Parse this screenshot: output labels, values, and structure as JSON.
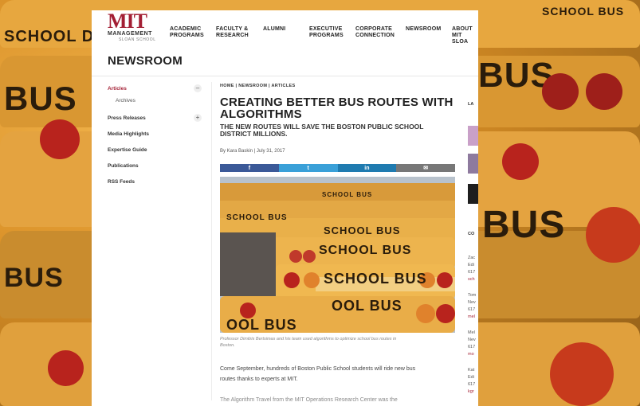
{
  "logo": {
    "mark": "MIT",
    "line1": "MANAGEMENT",
    "line2": "SLOAN SCHOOL"
  },
  "nav": [
    {
      "line1": "ACADEMIC",
      "line2": "PROGRAMS"
    },
    {
      "line1": "FACULTY &",
      "line2": "RESEARCH"
    },
    {
      "line1": "ALUMNI",
      "line2": ""
    },
    {
      "line1": "EXECUTIVE",
      "line2": "PROGRAMS"
    },
    {
      "line1": "CORPORATE",
      "line2": "CONNECTION"
    },
    {
      "line1": "NEWSROOM",
      "line2": ""
    },
    {
      "line1": "ABOUT",
      "line2": "MIT SLOA"
    }
  ],
  "page_title": "NEWSROOM",
  "sidebar": {
    "items": [
      {
        "label": "Articles",
        "toggle": "–"
      },
      {
        "label": "Archives"
      },
      {
        "label": "Press Releases",
        "toggle": "+"
      },
      {
        "label": "Media Highlights"
      },
      {
        "label": "Expertise Guide"
      },
      {
        "label": "Publications"
      },
      {
        "label": "RSS Feeds"
      }
    ]
  },
  "article": {
    "breadcrumb": [
      "HOME",
      "NEWSROOM",
      "ARTICLES"
    ],
    "breadcrumb_sep": "|",
    "headline_line1": "CREATING BETTER BUS ROUTES WITH",
    "headline_line2": "ALGORITHMS",
    "subhead_line1": "THE NEW ROUTES WILL SAVE THE BOSTON PUBLIC SCHOOL",
    "subhead_line2": "DISTRICT MILLIONS.",
    "byline": "By Kara Baskin  |  July 31, 2017",
    "share": {
      "facebook": "f",
      "twitter": "t",
      "linkedin": "in",
      "email": "✉",
      "colors": {
        "facebook": "#3b5998",
        "twitter": "#3aa0d8",
        "linkedin": "#1f7bb0",
        "email": "#777777"
      }
    },
    "photo_words": [
      "SCHOOL BUS",
      "SCHOOL BUS",
      "SCHOOL BUS",
      "SCHOOL BUS",
      "SCHOOL BUS",
      "OOL BUS",
      "OOL BUS"
    ],
    "caption_line1": "Professor Dimitris Bertsimas and his team used algorithms to optimize school bus routes in",
    "caption_line2": "Boston.",
    "body_line1": "Come September, hundreds of Boston Public School students will ride new bus",
    "body_line2": "routes thanks to experts at MIT.",
    "body_next": "The Algorithm Travel from the MIT Operations Research Center was the"
  },
  "right_col": {
    "latest": "LA",
    "contact": "CO",
    "lines": [
      {
        "text": "Zac",
        "link": false
      },
      {
        "text": "Edi",
        "link": false
      },
      {
        "text": "617",
        "link": false
      },
      {
        "text": "sch",
        "link": true
      },
      {
        "text": "Tom",
        "link": false
      },
      {
        "text": "Nev",
        "link": false
      },
      {
        "text": "617",
        "link": false
      },
      {
        "text": "mel",
        "link": true
      },
      {
        "text": "Mel",
        "link": false
      },
      {
        "text": "Nev",
        "link": false
      },
      {
        "text": "617",
        "link": false
      },
      {
        "text": "mo",
        "link": true
      },
      {
        "text": "Kat",
        "link": false
      },
      {
        "text": "Edi",
        "link": false
      },
      {
        "text": "617",
        "link": false
      },
      {
        "text": "kgr",
        "link": true
      }
    ]
  },
  "bg_words": [
    "SCHOOL DUS",
    "BUS",
    "BUS",
    "SCHOOL BUS",
    "BUS",
    "BUS"
  ],
  "colors": {
    "accent": "#a31f34",
    "bus_yellow": "#e8a23a",
    "lamp_red": "#c0392b"
  }
}
